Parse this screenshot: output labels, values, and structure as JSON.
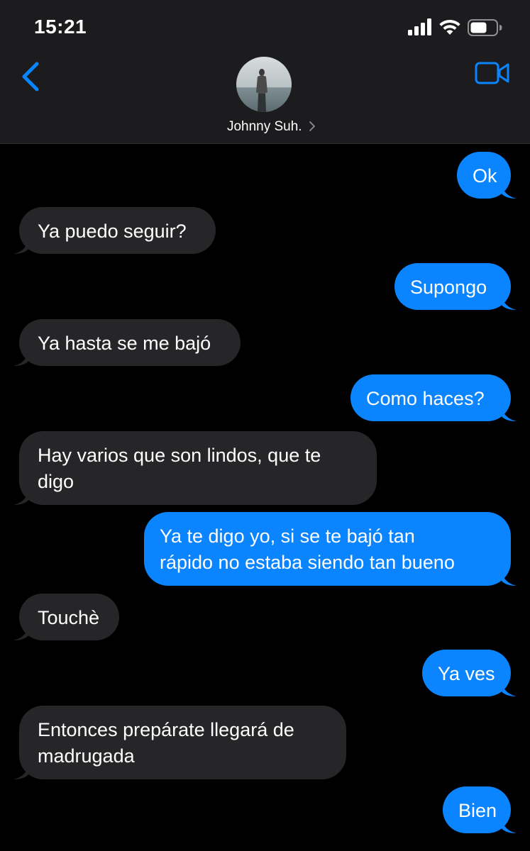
{
  "status_bar": {
    "time": "15:21",
    "icons": [
      "cellular-signal-icon",
      "wifi-icon",
      "battery-icon"
    ]
  },
  "header": {
    "contact_name": "Johnny Suh.",
    "icons": [
      "back-chevron-icon",
      "video-call-icon",
      "disclosure-chevron-icon"
    ]
  },
  "colors": {
    "background": "#000000",
    "header_background": "#1c1c1e",
    "incoming_bubble": "#262628",
    "outgoing_bubble": "#0a84ff",
    "accent": "#0a84ff"
  },
  "messages": [
    {
      "direction": "outgoing",
      "text": "Ok"
    },
    {
      "direction": "incoming",
      "text": "Ya puedo seguir?"
    },
    {
      "direction": "outgoing",
      "text": "Supongo"
    },
    {
      "direction": "incoming",
      "text": "Ya hasta se me bajó"
    },
    {
      "direction": "outgoing",
      "text": "Como haces?"
    },
    {
      "direction": "incoming",
      "lines": [
        "Hay varios que son lindos, que te",
        "digo"
      ]
    },
    {
      "direction": "outgoing",
      "lines": [
        "Ya te digo yo, si se te bajó tan",
        "rápido no estaba siendo tan bueno"
      ]
    },
    {
      "direction": "incoming",
      "text": "Touchè"
    },
    {
      "direction": "outgoing",
      "text": "Ya ves"
    },
    {
      "direction": "incoming",
      "lines": [
        "Entonces prepárate llegará de",
        "madrugada"
      ]
    },
    {
      "direction": "outgoing",
      "text": "Bien"
    }
  ]
}
